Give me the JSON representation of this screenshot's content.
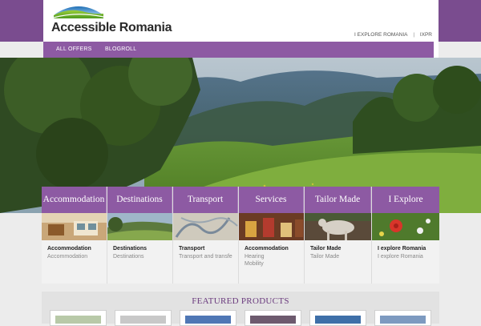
{
  "header": {
    "logo_text": "Accessible Romania",
    "top_links": [
      "I EXPLORE ROMANIA",
      "IXPR"
    ],
    "separator": "|"
  },
  "nav": {
    "items": [
      "ALL OFFERS",
      "BLOGROLL"
    ]
  },
  "categories": [
    {
      "tab": "Accommodation",
      "title": "Accommodation",
      "sub": [
        "Accommodation"
      ]
    },
    {
      "tab": "Destinations",
      "title": "Destinations",
      "sub": [
        "Destinations"
      ]
    },
    {
      "tab": "Transport",
      "title": "Transport",
      "sub": [
        "Transport and transfe"
      ]
    },
    {
      "tab": "Services",
      "title": "Accommodation",
      "sub": [
        "Hearing",
        "Mobility"
      ]
    },
    {
      "tab": "Tailor Made",
      "title": "Tailor Made",
      "sub": [
        "Tailor Made"
      ]
    },
    {
      "tab": "I Explore",
      "title": "I explore Romania",
      "sub": [
        "I explore Romania"
      ]
    }
  ],
  "featured": {
    "title": "FEATURED PRODUCTS"
  },
  "colors": {
    "brand_purple": "#8d5aa3",
    "band_purple": "#7a4c8f",
    "featured_title": "#6a3a7e"
  },
  "icons": [
    "logo-hills-icon"
  ]
}
